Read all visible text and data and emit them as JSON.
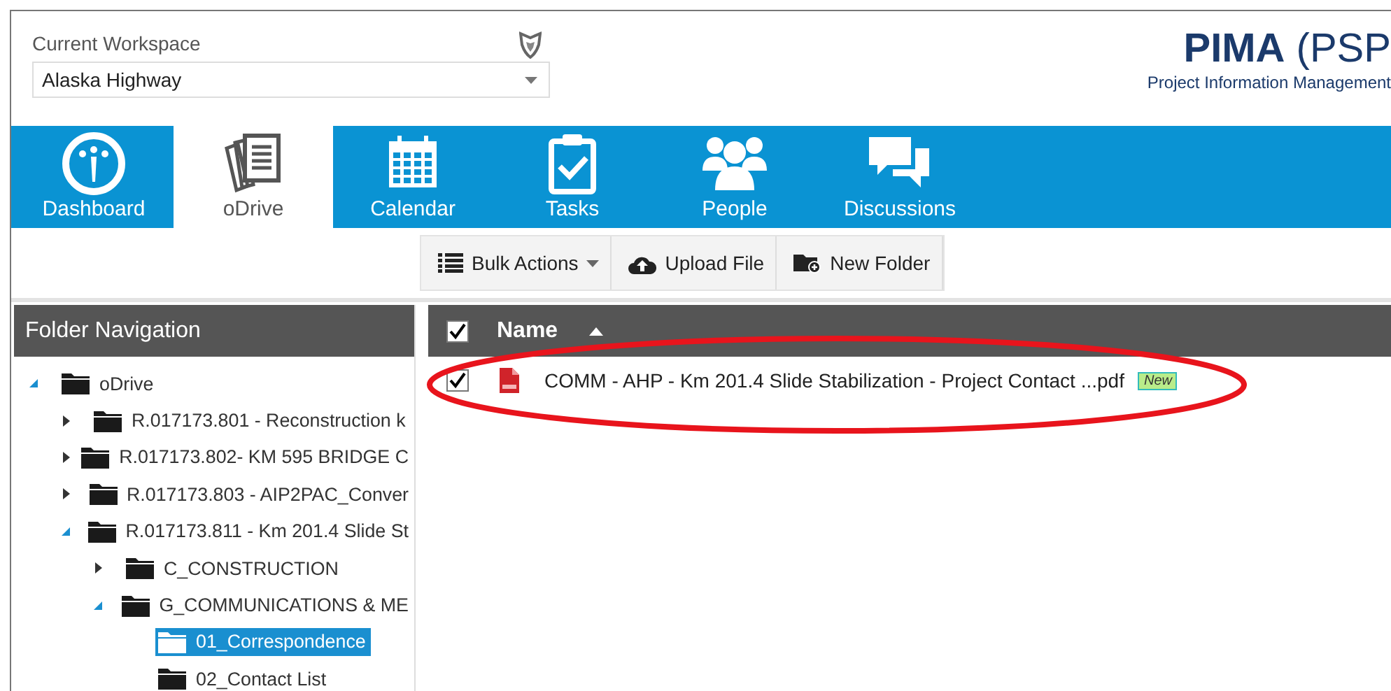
{
  "workspace": {
    "label": "Current Workspace",
    "value": "Alaska Highway"
  },
  "brand": {
    "title": "**PIMA** (PSP",
    "subtitle": "Project Information Management"
  },
  "tabs": [
    {
      "label": "Dashboard",
      "selected": false
    },
    {
      "label": "oDrive",
      "selected": true
    },
    {
      "label": "Calendar",
      "selected": false
    },
    {
      "label": "Tasks",
      "selected": false
    },
    {
      "label": "People",
      "selected": false
    },
    {
      "label": "Discussions",
      "selected": false
    }
  ],
  "toolbar": [
    {
      "label": "Bulk Actions",
      "kind": "dropdown"
    },
    {
      "label": "Upload File",
      "kind": "button"
    },
    {
      "label": "New Folder",
      "kind": "button"
    }
  ],
  "folder_navigation": {
    "title": "Folder Navigation",
    "tree": [
      {
        "label": "oDrive",
        "expanded": true,
        "selected": false,
        "children": [
          {
            "label": "R.017173.801 - Reconstruction k",
            "expanded": false,
            "selected": false
          },
          {
            "label": "R.017173.802- KM 595 BRIDGE C",
            "expanded": false,
            "selected": false
          },
          {
            "label": "R.017173.803 - AIP2PAC_Conver",
            "expanded": false,
            "selected": false
          },
          {
            "label": "R.017173.811 - Km 201.4 Slide St",
            "expanded": true,
            "selected": false,
            "children": [
              {
                "label": "C_CONSTRUCTION",
                "expanded": false,
                "selected": false
              },
              {
                "label": "G_COMMUNICATIONS & ME",
                "expanded": true,
                "selected": false,
                "children": [
                  {
                    "label": "01_Correspondence",
                    "selected": true
                  },
                  {
                    "label": "02_Contact List",
                    "selected": false
                  }
                ]
              }
            ]
          }
        ]
      }
    ]
  },
  "files": {
    "header": {
      "label": "Name",
      "checked": true
    },
    "rows": [
      {
        "name": "COMM - AHP - Km 201.4 Slide Stabilization - Project Contact ...pdf",
        "badge": "New",
        "checked": true
      }
    ]
  }
}
